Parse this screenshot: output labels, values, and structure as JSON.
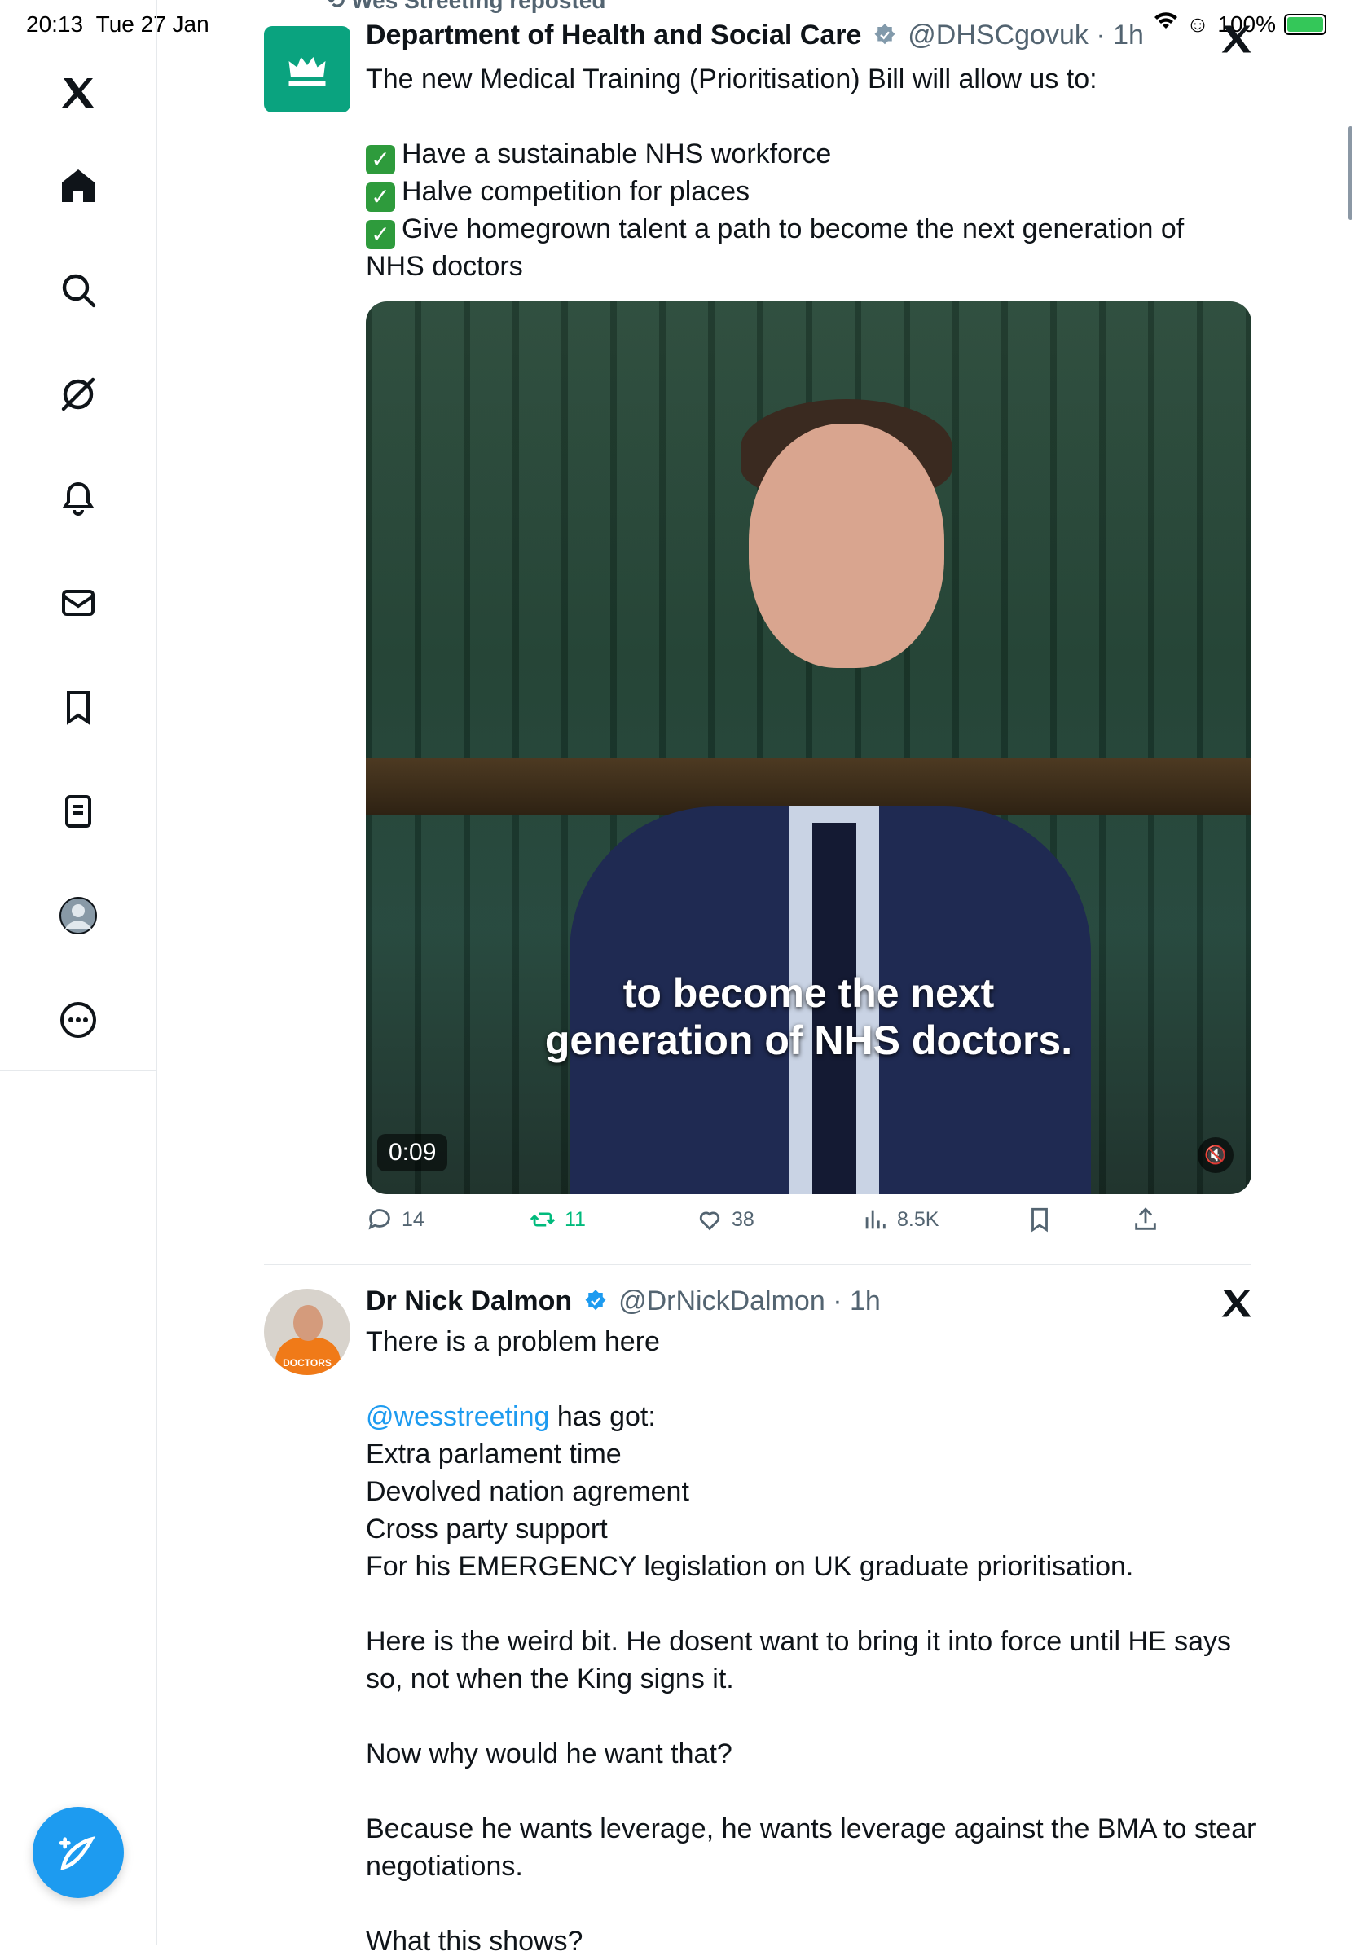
{
  "status": {
    "time": "20:13",
    "date": "Tue 27 Jan",
    "battery": "100%"
  },
  "rail": {
    "items": [
      "home",
      "search",
      "grok",
      "notifications",
      "messages",
      "bookmarks",
      "lists",
      "profile",
      "more"
    ]
  },
  "post1": {
    "repost_label": "Wes Streeting reposted",
    "author_name": "Department of Health and Social Care",
    "handle": "@DHSCgovuk",
    "dot": "·",
    "time": "1h",
    "line1": "The new Medical Training (Prioritisation) Bill will allow us to:",
    "bullets": [
      "Have a sustainable NHS workforce",
      "Halve competition for places",
      "Give homegrown talent a path to become the next generation of"
    ],
    "bullet_tail": "NHS doctors",
    "video": {
      "caption_line1": "to become the next",
      "caption_line2": "generation of NHS doctors.",
      "time": "0:09"
    },
    "metrics": {
      "replies": "14",
      "reposts": "11",
      "likes": "38",
      "views": "8.5K"
    }
  },
  "post2": {
    "author_name": "Dr Nick Dalmon",
    "handle": "@DrNickDalmon",
    "dot": "·",
    "time": "1h",
    "avatar_tag": "DOCTORS",
    "line1": "There is a problem here",
    "mention": "@wesstreeting",
    "mention_tail": " has got:",
    "list": [
      "Extra parlament time",
      "Devolved nation agrement",
      "Cross party support",
      "For his EMERGENCY legislation on UK graduate prioritisation."
    ],
    "para2_l1": "Here is the weird bit. He dosent want to bring it into force until HE says",
    "para2_l2": "so, not when the King signs it.",
    "para3": "Now why would he want that?",
    "para4_l1": "Because he wants leverage, he wants leverage against the BMA to stear",
    "para4_l2": "negotiations.",
    "para5": "What this shows?"
  },
  "colors": {
    "accent": "#1d9bf0",
    "repost_green": "#00ba7c",
    "dhsc_green": "#0aa37f"
  }
}
